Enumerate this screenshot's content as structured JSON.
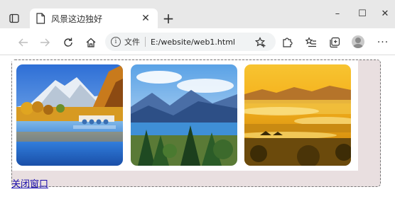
{
  "browser": {
    "tab": {
      "title": "风景这边独好"
    },
    "new_tab_symbol": "+",
    "window_controls": {
      "minimize": "–",
      "maximize": "☐",
      "close": "✕"
    },
    "address_bar": {
      "scheme_label": "文件",
      "url": "E:/website/web1.html"
    },
    "more_symbol": "···"
  },
  "page": {
    "images": [
      {
        "name": "mountain-lake-bridge",
        "alt": "snow mountain lake with autumn trees and stone bridge"
      },
      {
        "name": "valley-lake-pines",
        "alt": "blue mountain valley with lake and pine trees"
      },
      {
        "name": "golden-misty-fields",
        "alt": "golden sunrise over misty terraced fields"
      }
    ],
    "close_link": "关闭窗口"
  },
  "colors": {
    "gallery_bg": "#e9dfe0",
    "link": "#1a0dab"
  }
}
